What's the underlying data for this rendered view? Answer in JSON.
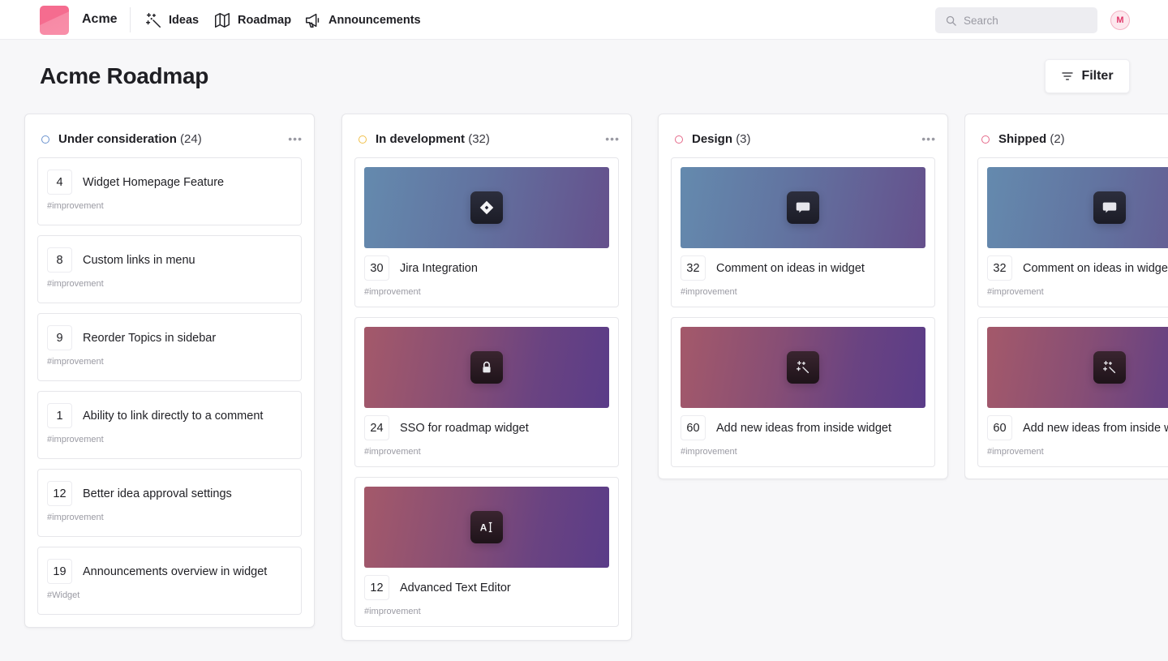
{
  "nav": {
    "brand": "Acme",
    "items": [
      {
        "label": "Ideas",
        "icon": "magic-wand-icon"
      },
      {
        "label": "Roadmap",
        "icon": "map-icon"
      },
      {
        "label": "Announcements",
        "icon": "megaphone-icon"
      }
    ],
    "search_placeholder": "Search",
    "avatar_initial": "M"
  },
  "page": {
    "title": "Acme Roadmap",
    "filter_label": "Filter"
  },
  "colors": {
    "under_consideration": "#6b93cf",
    "in_development": "#f0c04a",
    "design": "#e56a8a",
    "shipped": "#e56a8a",
    "accent": "#f56c8f"
  },
  "columns": [
    {
      "title": "Under consideration",
      "count": "(24)",
      "cards": [
        {
          "votes": "4",
          "title": "Widget Homepage Feature",
          "tag": "#improvement"
        },
        {
          "votes": "8",
          "title": "Custom links in menu",
          "tag": "#improvement"
        },
        {
          "votes": "9",
          "title": "Reorder Topics in sidebar",
          "tag": "#improvement"
        },
        {
          "votes": "1",
          "title": "Ability to link directly to a comment",
          "tag": "#improvement"
        },
        {
          "votes": "12",
          "title": "Better idea approval settings",
          "tag": "#improvement"
        },
        {
          "votes": "19",
          "title": "Announcements overview in widget",
          "tag": "#Widget"
        }
      ]
    },
    {
      "title": "In development",
      "count": "(32)",
      "cards": [
        {
          "votes": "30",
          "title": "Jira Integration",
          "tag": "#improvement",
          "icon": "jira-icon"
        },
        {
          "votes": "24",
          "title": "SSO for roadmap widget",
          "tag": "#improvement",
          "icon": "lock-icon"
        },
        {
          "votes": "12",
          "title": "Advanced Text Editor",
          "tag": "#improvement",
          "icon": "text-cursor-icon"
        }
      ]
    },
    {
      "title": "Design",
      "count": "(3)",
      "cards": [
        {
          "votes": "32",
          "title": "Comment on ideas in widget",
          "tag": "#improvement",
          "icon": "chat-bubble-icon"
        },
        {
          "votes": "60",
          "title": "Add new ideas from inside widget",
          "tag": "#improvement",
          "icon": "magic-wand-icon"
        }
      ]
    },
    {
      "title": "Shipped",
      "count": "(2)",
      "cards": [
        {
          "votes": "32",
          "title": "Comment on ideas in widget",
          "tag": "#improvement",
          "icon": "chat-bubble-icon"
        },
        {
          "votes": "60",
          "title": "Add new ideas from inside widget",
          "tag": "#improvement",
          "icon": "magic-wand-icon"
        }
      ]
    }
  ]
}
